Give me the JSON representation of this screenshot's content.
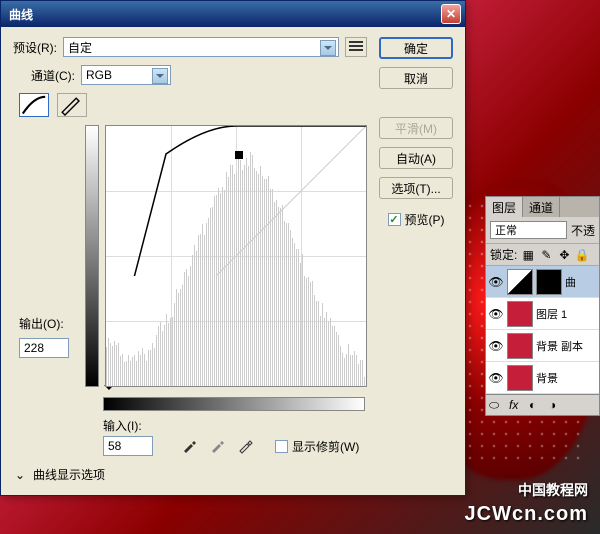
{
  "dialog": {
    "title": "曲线",
    "preset_label": "预设(R):",
    "preset_value": "自定",
    "channel_label": "通道(C):",
    "channel_value": "RGB",
    "output_label": "输出(O):",
    "output_value": "228",
    "input_label": "输入(I):",
    "input_value": "58",
    "show_clipping_label": "显示修剪(W)",
    "options_label": "曲线显示选项",
    "buttons": {
      "ok": "确定",
      "cancel": "取消",
      "smooth": "平滑(M)",
      "auto": "自动(A)",
      "options": "选项(T)...",
      "preview": "预览(P)"
    }
  },
  "chart_data": {
    "type": "line",
    "title": "曲线",
    "xlabel": "输入",
    "ylabel": "输出",
    "xlim": [
      0,
      255
    ],
    "ylim": [
      0,
      255
    ],
    "series": [
      {
        "name": "RGB",
        "values": [
          [
            0,
            0
          ],
          [
            58,
            228
          ],
          [
            128,
            255
          ],
          [
            255,
            255
          ]
        ]
      }
    ],
    "control_points": [
      {
        "x": 58,
        "y": 228
      }
    ],
    "histogram_peak_range": [
      100,
      180
    ]
  },
  "layers": {
    "tab_layers": "图层",
    "tab_channels": "通道",
    "blend_mode": "正常",
    "opacity_label": "不透",
    "lock_label": "锁定:",
    "items": [
      {
        "name": "曲",
        "type": "curves"
      },
      {
        "name": "图层 1",
        "type": "normal"
      },
      {
        "name": "背景 副本",
        "type": "normal"
      },
      {
        "name": "背景",
        "type": "normal"
      }
    ]
  },
  "watermark": {
    "cn": "中国教程网",
    "en": "JCWcn.com"
  }
}
